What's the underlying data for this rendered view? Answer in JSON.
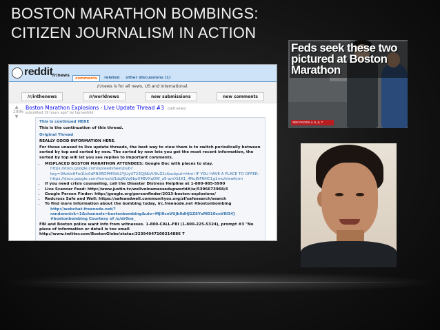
{
  "slide": {
    "title_line1": "BOSTON MARATHON BOMBINGS:",
    "title_line2": "CITIZEN JOURNALISM IN ACTION"
  },
  "reddit": {
    "logo": "reddit",
    "subreddit": "/r/news",
    "tabs": [
      "comments",
      "related",
      "other discussions (1)"
    ],
    "notice": "/r/news is for all news, US and international.",
    "nav_buttons": [
      "/r/inthenews",
      "/r/worldnews",
      "new submissions",
      "new comments"
    ],
    "post_title": "Boston Marathon Explosions - Live Update Thread #3",
    "post_domain": "(self.news)",
    "post_meta": "submitted 19 hours ago* by hgmanfold",
    "body": {
      "line1": "This is continued HERE",
      "line2": "This is the continuation of this thread.",
      "line3": "Original Thread",
      "line4": "REALLY GOOD INFORMATION HERE.",
      "para": "For those unused to live update threads, the best way to view them is to switch periodically between sorted by top and sorted by new. The sorted by new lets you get the most recent information, the sorted by top will let you see replies to important comments.",
      "bullets": [
        "MISPLACED BOSTON MARATHON ATTENDEES: Google Doc with places to stay.",
        "If you need crisis counseling, call the Disaster Distress Helpline at 1-800-985-5990",
        "Live Scanner Feed: http://www.justin.tv/wellvoinamessedupworld#/w/5396673968/4",
        "Google Person Finder: http://google.org/personfinder/2013-boston-explosions/",
        "Redcross Safe and Well: https://safeandwell.communityos.org/zf/safesearch/search",
        "To find more information about the bombing today, irc.freenode.net #bostonbombing"
      ],
      "doc_links": "https://docs.google.com/spreadsheet/pub?key=0AoVxHFw1Uc0dFN3RDM4SVk2YjUyUT23QjNLVU9vZ2c&output=html IF YOU HAVE A PLACE TO OFFER: https://docs.google.com/forms/d/1dqJKVq6bpX4BVXqOW_a9-qmXt1K1_4NuJNFNHC1g1mo/viewform",
      "irc_links": "http://webchat.freenode.net/?randomnick=1&channels=bostonbombing&uio=MjI0cnVUJk9dHJ1ZSYxMD10cnV8I34] #bostonbombing Courtesy of /u/dr0ne_",
      "footer": "FBI and Boston police want info from witnesses. 1-800-CALL-FBI (1-800-225-5324), prompt #3 \"No piece of information or detail is too small http://www.twitter.com/BostonGlobe/status/32394947100214886 7"
    },
    "vote_count": "2996"
  },
  "newspaper": {
    "headline": "Feds seek these two pictured at Boston Marathon",
    "caption": "SEE PAGES 4, 5, 6, 7"
  }
}
